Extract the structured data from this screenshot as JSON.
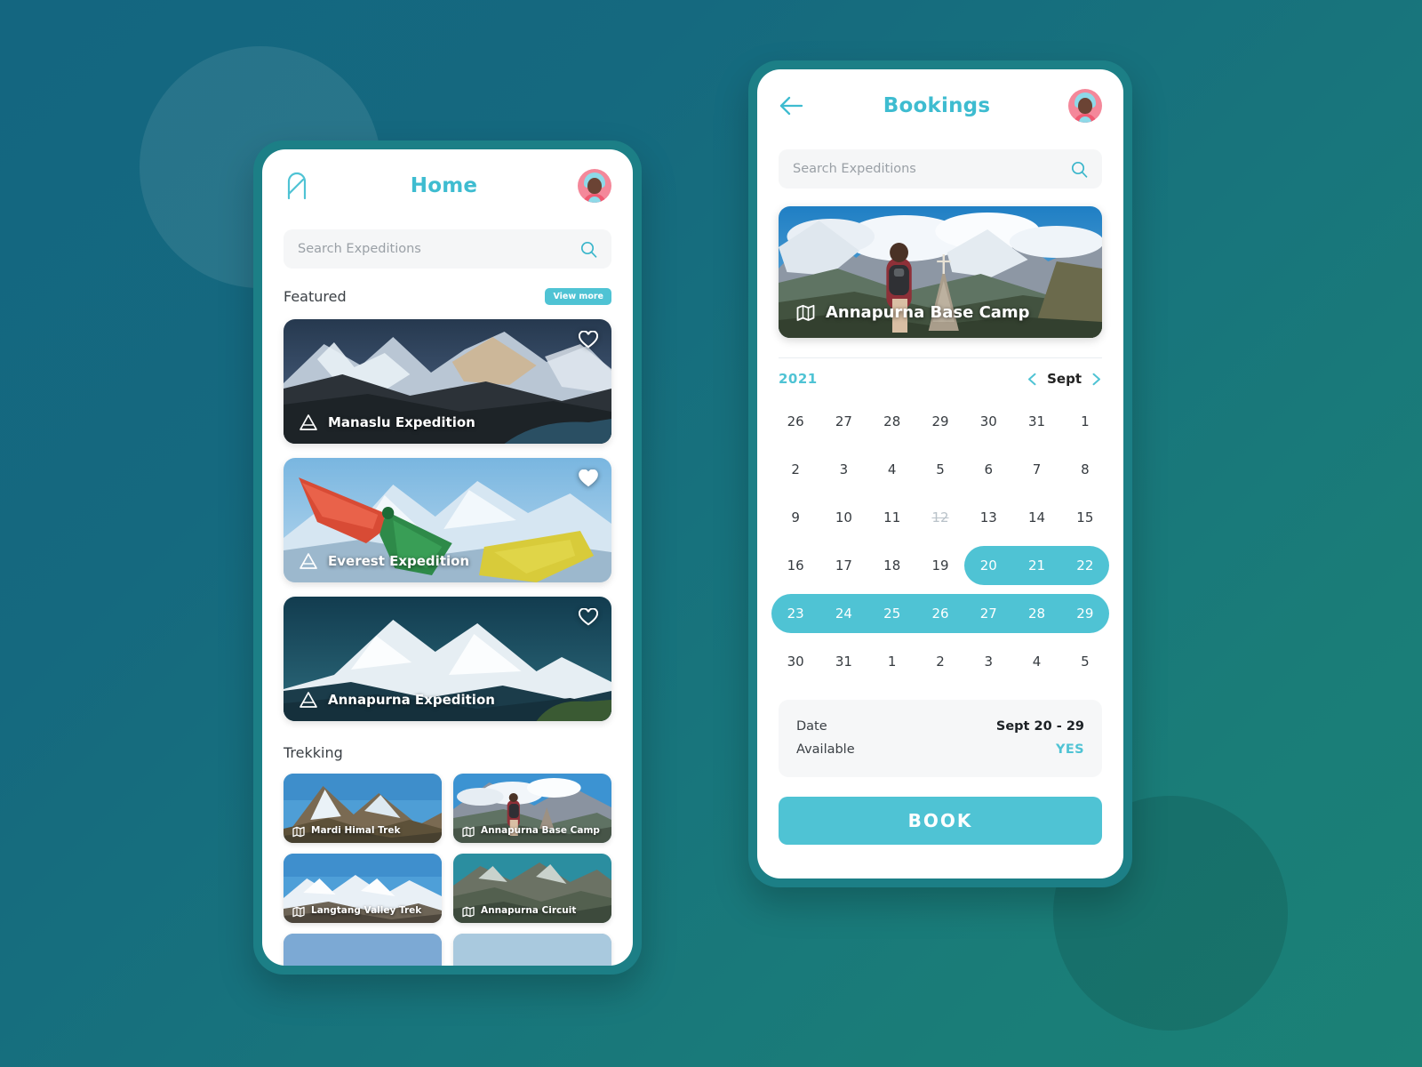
{
  "theme": {
    "accent": "#4fc3d4",
    "bg_gradient_from": "#146680",
    "bg_gradient_to": "#1b8176",
    "phone_frame": "#1c7f86"
  },
  "home_screen": {
    "logo_icon": "app-logo-icon",
    "title": "Home",
    "avatar_icon": "user-avatar",
    "search": {
      "placeholder": "Search Expeditions",
      "value": "",
      "icon": "search-icon"
    },
    "featured": {
      "section_label": "Featured",
      "view_more_label": "View more",
      "cards": [
        {
          "title": "Manaslu Expedition",
          "icon": "mountain-icon",
          "favorite": false
        },
        {
          "title": "Everest Expedition",
          "icon": "mountain-icon",
          "favorite": true
        },
        {
          "title": "Annapurna Expedition",
          "icon": "mountain-icon",
          "favorite": false
        }
      ]
    },
    "trekking": {
      "section_label": "Trekking",
      "cards": [
        {
          "title": "Mardi Himal Trek",
          "icon": "map-icon"
        },
        {
          "title": "Annapurna Base Camp",
          "icon": "map-icon"
        },
        {
          "title": "Langtang Valley Trek",
          "icon": "map-icon"
        },
        {
          "title": "Annapurna Circuit",
          "icon": "map-icon"
        }
      ]
    }
  },
  "bookings_screen": {
    "back_icon": "back-arrow-icon",
    "title": "Bookings",
    "avatar_icon": "user-avatar",
    "search": {
      "placeholder": "Search Expeditions",
      "value": "",
      "icon": "search-icon"
    },
    "hero": {
      "title": "Annapurna Base Camp",
      "icon": "map-icon"
    },
    "calendar": {
      "year": "2021",
      "month": "Sept",
      "prev_icon": "chevron-left-icon",
      "next_icon": "chevron-right-icon",
      "weeks": [
        [
          {
            "d": "26",
            "state": "out"
          },
          {
            "d": "27",
            "state": "out"
          },
          {
            "d": "28",
            "state": "out"
          },
          {
            "d": "29",
            "state": "out"
          },
          {
            "d": "30",
            "state": "out"
          },
          {
            "d": "31",
            "state": "out"
          },
          {
            "d": "1",
            "state": "normal"
          }
        ],
        [
          {
            "d": "2",
            "state": "normal"
          },
          {
            "d": "3",
            "state": "normal"
          },
          {
            "d": "4",
            "state": "normal"
          },
          {
            "d": "5",
            "state": "normal"
          },
          {
            "d": "6",
            "state": "normal"
          },
          {
            "d": "7",
            "state": "normal"
          },
          {
            "d": "8",
            "state": "normal"
          }
        ],
        [
          {
            "d": "9",
            "state": "normal"
          },
          {
            "d": "10",
            "state": "normal"
          },
          {
            "d": "11",
            "state": "normal"
          },
          {
            "d": "12",
            "state": "disabled"
          },
          {
            "d": "13",
            "state": "normal"
          },
          {
            "d": "14",
            "state": "normal"
          },
          {
            "d": "15",
            "state": "normal"
          }
        ],
        [
          {
            "d": "16",
            "state": "normal"
          },
          {
            "d": "17",
            "state": "normal"
          },
          {
            "d": "18",
            "state": "normal"
          },
          {
            "d": "19",
            "state": "normal"
          },
          {
            "d": "20",
            "state": "selected",
            "pill": "start"
          },
          {
            "d": "21",
            "state": "selected",
            "pill": "mid"
          },
          {
            "d": "22",
            "state": "selected",
            "pill": "mid"
          }
        ],
        [
          {
            "d": "23",
            "state": "selected",
            "pill": "start"
          },
          {
            "d": "24",
            "state": "selected",
            "pill": "mid"
          },
          {
            "d": "25",
            "state": "selected",
            "pill": "mid"
          },
          {
            "d": "26",
            "state": "selected",
            "pill": "mid"
          },
          {
            "d": "27",
            "state": "selected",
            "pill": "mid"
          },
          {
            "d": "28",
            "state": "selected",
            "pill": "mid"
          },
          {
            "d": "29",
            "state": "selected",
            "pill": "end"
          }
        ],
        [
          {
            "d": "30",
            "state": "normal"
          },
          {
            "d": "31",
            "state": "out"
          },
          {
            "d": "1",
            "state": "out"
          },
          {
            "d": "2",
            "state": "out"
          },
          {
            "d": "3",
            "state": "out"
          },
          {
            "d": "4",
            "state": "out"
          },
          {
            "d": "5",
            "state": "out"
          }
        ]
      ]
    },
    "info": [
      {
        "key": "Date",
        "value": "Sept 20 - 29",
        "highlight": false
      },
      {
        "key": "Available",
        "value": "YES",
        "highlight": true
      }
    ],
    "book_button_label": "BOOK"
  }
}
